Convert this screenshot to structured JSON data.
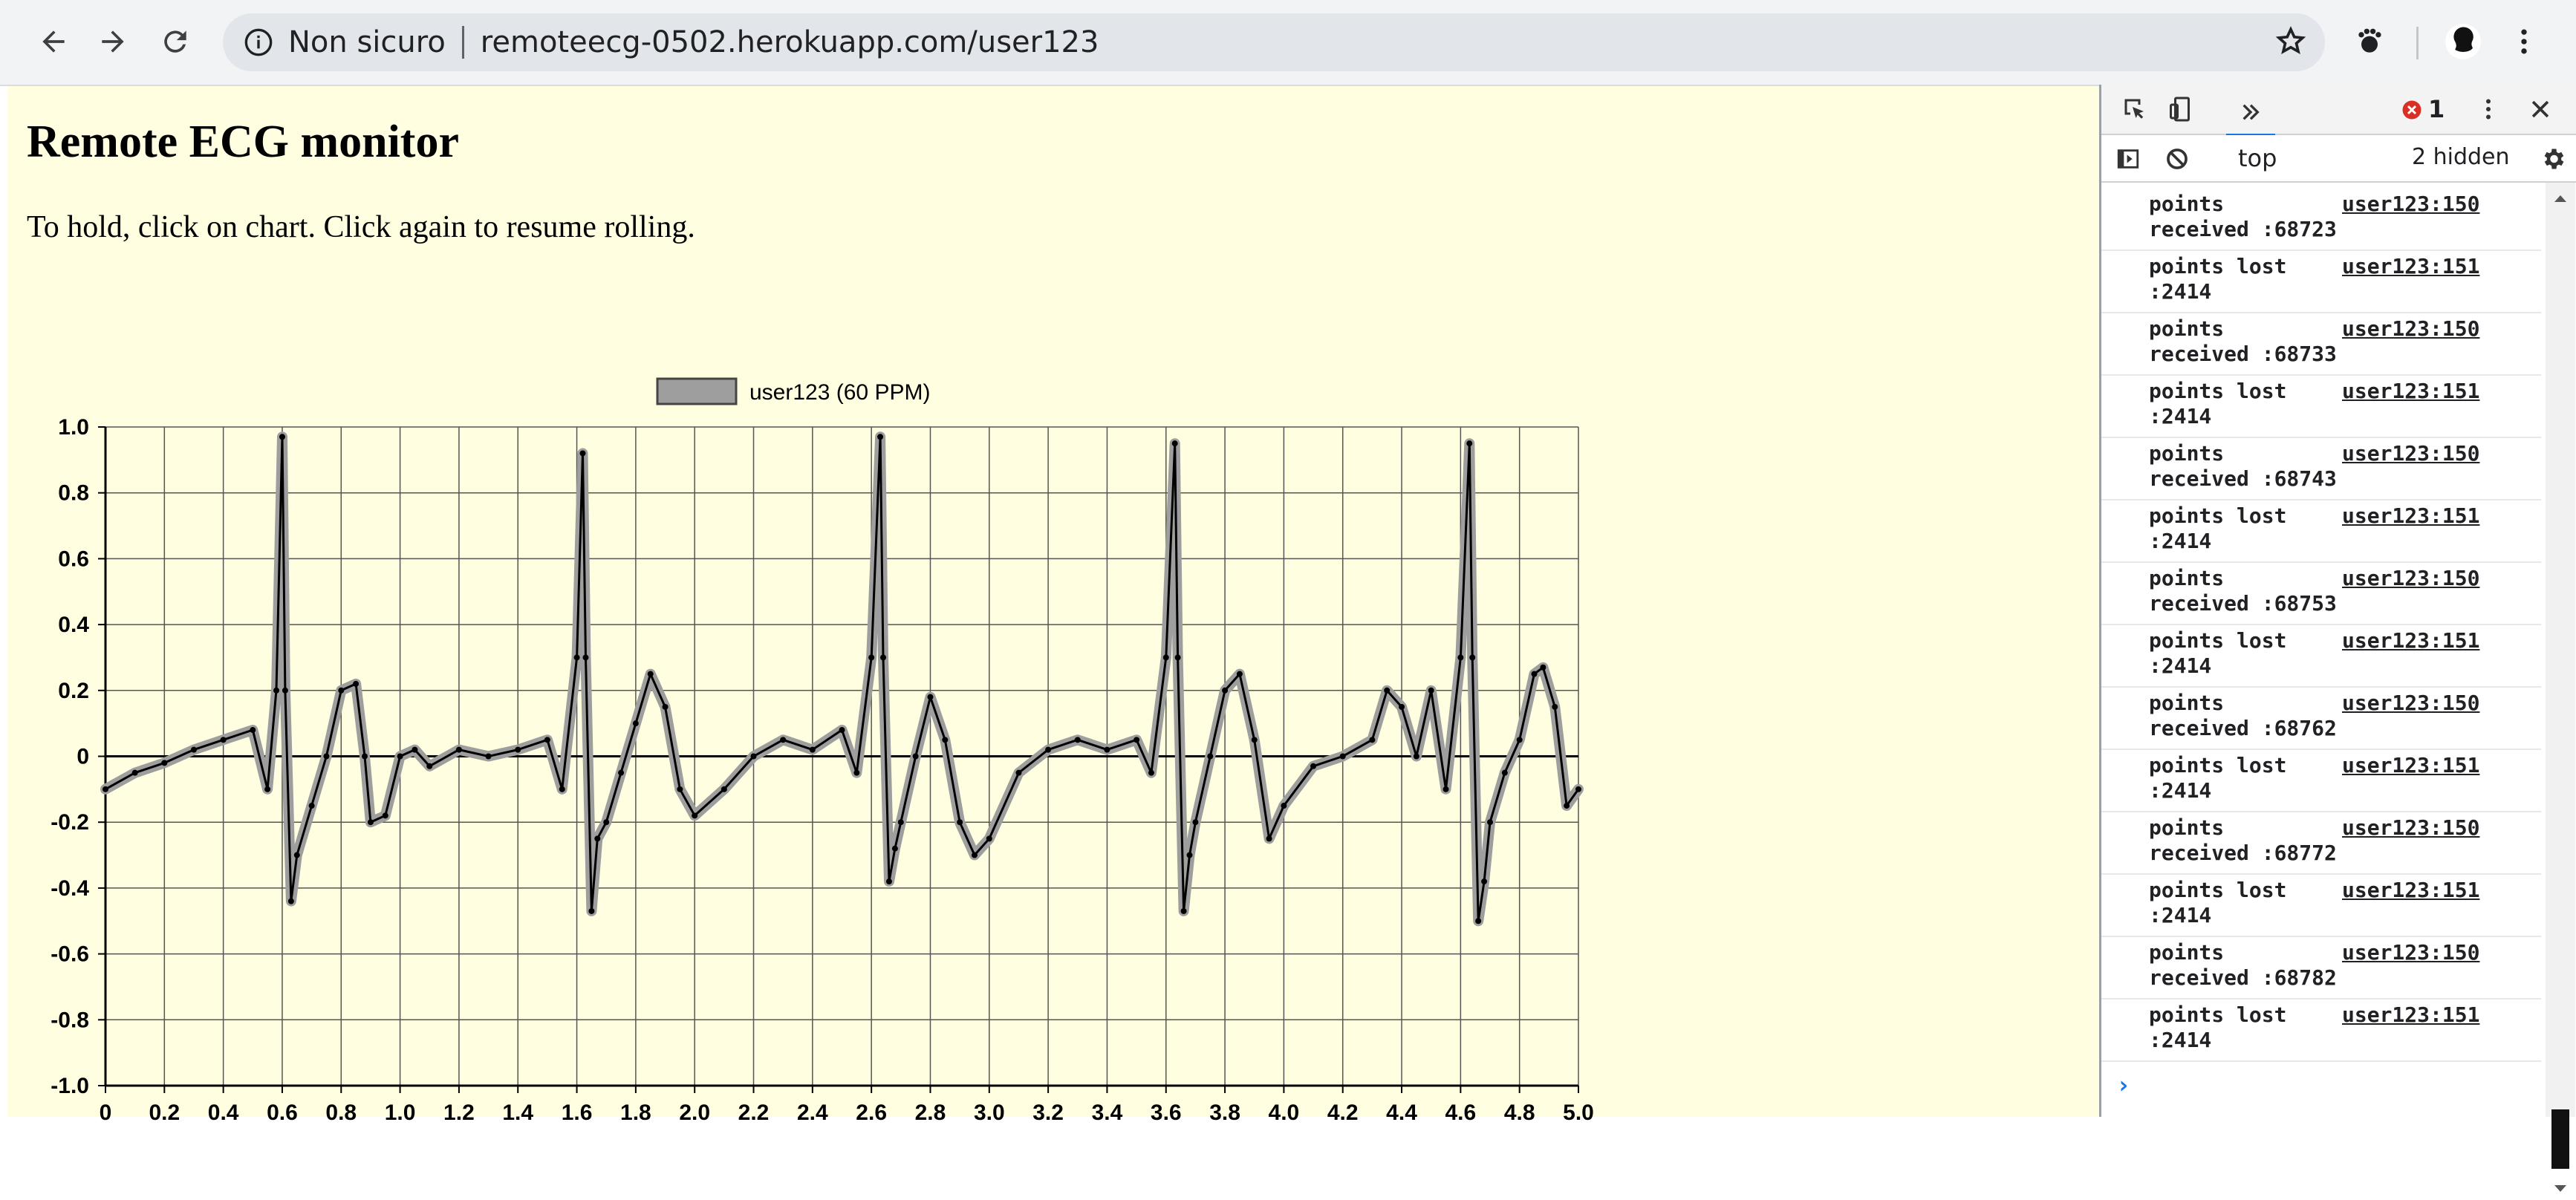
{
  "browser": {
    "security_label": "Non sicuro",
    "url": "remoteecg-0502.herokuapp.com/user123",
    "icons": [
      "back-arrow-icon",
      "forward-arrow-icon",
      "reload-icon",
      "info-icon",
      "star-icon",
      "extension-icon",
      "avatar-icon",
      "menu-dots-icon"
    ]
  },
  "page": {
    "title": "Remote ECG monitor",
    "instructions": "To hold, click on chart. Click again to resume rolling."
  },
  "chart_data": {
    "type": "line",
    "legend": [
      "user123 (60 PPM)"
    ],
    "xlim": [
      0,
      5.0
    ],
    "ylim": [
      -1.0,
      1.0
    ],
    "x_ticks": [
      "0",
      "0.2",
      "0.4",
      "0.6",
      "0.8",
      "1.0",
      "1.2",
      "1.4",
      "1.6",
      "1.8",
      "2.0",
      "2.2",
      "2.4",
      "2.6",
      "2.8",
      "3.0",
      "3.2",
      "3.4",
      "3.6",
      "3.8",
      "4.0",
      "4.2",
      "4.4",
      "4.6",
      "4.8",
      "5.0"
    ],
    "y_ticks": [
      "1.0",
      "0.8",
      "0.6",
      "0.4",
      "0.2",
      "0",
      "-0.2",
      "-0.4",
      "-0.6",
      "-0.8",
      "-1.0"
    ],
    "grid": true,
    "series": [
      {
        "name": "user123 (60 PPM)",
        "color": "#000000",
        "band_color": "#9e9e9e",
        "x": [
          0,
          0.1,
          0.2,
          0.3,
          0.4,
          0.5,
          0.55,
          0.58,
          0.6,
          0.61,
          0.63,
          0.65,
          0.7,
          0.75,
          0.8,
          0.85,
          0.88,
          0.9,
          0.95,
          1.0,
          1.05,
          1.1,
          1.2,
          1.3,
          1.4,
          1.5,
          1.55,
          1.6,
          1.62,
          1.63,
          1.65,
          1.67,
          1.7,
          1.75,
          1.8,
          1.85,
          1.9,
          1.95,
          2.0,
          2.1,
          2.2,
          2.3,
          2.4,
          2.5,
          2.55,
          2.6,
          2.63,
          2.64,
          2.66,
          2.68,
          2.7,
          2.75,
          2.8,
          2.85,
          2.9,
          2.95,
          3.0,
          3.1,
          3.2,
          3.3,
          3.4,
          3.5,
          3.55,
          3.6,
          3.63,
          3.64,
          3.66,
          3.68,
          3.7,
          3.75,
          3.8,
          3.85,
          3.9,
          3.95,
          4.0,
          4.1,
          4.2,
          4.3,
          4.35,
          4.4,
          4.45,
          4.5,
          4.55,
          4.6,
          4.63,
          4.64,
          4.66,
          4.68,
          4.7,
          4.75,
          4.8,
          4.85,
          4.88,
          4.92,
          4.96,
          5.0
        ],
        "y": [
          -0.1,
          -0.05,
          -0.02,
          0.02,
          0.05,
          0.08,
          -0.1,
          0.2,
          0.97,
          0.2,
          -0.44,
          -0.3,
          -0.15,
          0.0,
          0.2,
          0.22,
          0.0,
          -0.2,
          -0.18,
          0.0,
          0.02,
          -0.03,
          0.02,
          0.0,
          0.02,
          0.05,
          -0.1,
          0.3,
          0.92,
          0.3,
          -0.47,
          -0.25,
          -0.2,
          -0.05,
          0.1,
          0.25,
          0.15,
          -0.1,
          -0.18,
          -0.1,
          0.0,
          0.05,
          0.02,
          0.08,
          -0.05,
          0.3,
          0.97,
          0.3,
          -0.38,
          -0.28,
          -0.2,
          0.0,
          0.18,
          0.05,
          -0.2,
          -0.3,
          -0.25,
          -0.05,
          0.02,
          0.05,
          0.02,
          0.05,
          -0.05,
          0.3,
          0.95,
          0.3,
          -0.47,
          -0.3,
          -0.2,
          0.0,
          0.2,
          0.25,
          0.05,
          -0.25,
          -0.15,
          -0.03,
          0.0,
          0.05,
          0.2,
          0.15,
          0.0,
          0.2,
          -0.1,
          0.3,
          0.95,
          0.3,
          -0.5,
          -0.38,
          -0.2,
          -0.05,
          0.05,
          0.25,
          0.27,
          0.15,
          -0.15,
          -0.1
        ]
      }
    ]
  },
  "devtools": {
    "error_count": "1",
    "context": "top",
    "hidden": "2 hidden",
    "logs": [
      {
        "msg": "points\nreceived :68723",
        "src": "user123:150"
      },
      {
        "msg": "points lost\n:2414",
        "src": "user123:151"
      },
      {
        "msg": "points\nreceived :68733",
        "src": "user123:150"
      },
      {
        "msg": "points lost\n:2414",
        "src": "user123:151"
      },
      {
        "msg": "points\nreceived :68743",
        "src": "user123:150"
      },
      {
        "msg": "points lost\n:2414",
        "src": "user123:151"
      },
      {
        "msg": "points\nreceived :68753",
        "src": "user123:150"
      },
      {
        "msg": "points lost\n:2414",
        "src": "user123:151"
      },
      {
        "msg": "points\nreceived :68762",
        "src": "user123:150"
      },
      {
        "msg": "points lost\n:2414",
        "src": "user123:151"
      },
      {
        "msg": "points\nreceived :68772",
        "src": "user123:150"
      },
      {
        "msg": "points lost\n:2414",
        "src": "user123:151"
      },
      {
        "msg": "points\nreceived :68782",
        "src": "user123:150"
      },
      {
        "msg": "points lost\n:2414",
        "src": "user123:151"
      }
    ],
    "prompt": "›"
  }
}
